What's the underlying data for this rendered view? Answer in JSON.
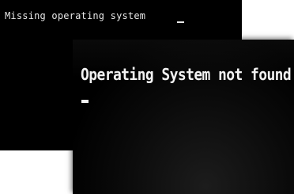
{
  "back_screen": {
    "message": "Missing operating system"
  },
  "front_screen": {
    "message": "Operating System not found"
  },
  "colors": {
    "screen_background": "#000000",
    "text": "#e8e8e8",
    "page_background": "#ffffff"
  }
}
